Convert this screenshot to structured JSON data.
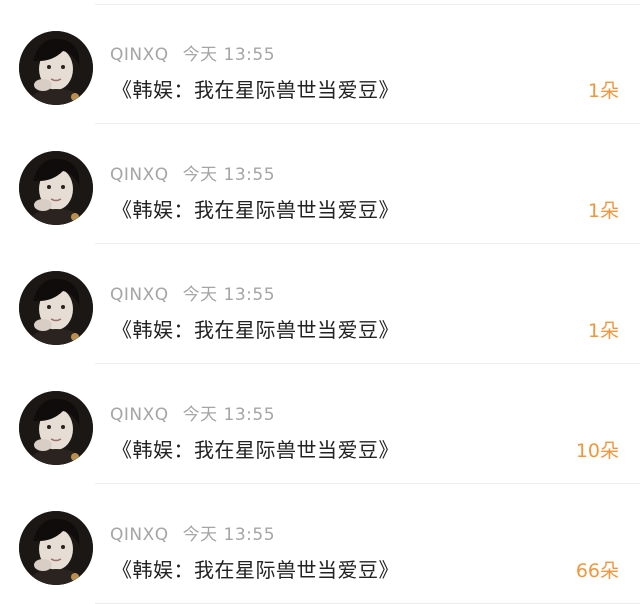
{
  "messages": [
    {
      "username": "QINXQ",
      "time": "今天 13:55",
      "title": "《韩娱：我在星际兽世当爱豆》",
      "amount": "1朵"
    },
    {
      "username": "QINXQ",
      "time": "今天 13:55",
      "title": "《韩娱：我在星际兽世当爱豆》",
      "amount": "1朵"
    },
    {
      "username": "QINXQ",
      "time": "今天 13:55",
      "title": "《韩娱：我在星际兽世当爱豆》",
      "amount": "1朵"
    },
    {
      "username": "QINXQ",
      "time": "今天 13:55",
      "title": "《韩娱：我在星际兽世当爱豆》",
      "amount": "10朵"
    },
    {
      "username": "QINXQ",
      "time": "今天 13:55",
      "title": "《韩娱：我在星际兽世当爱豆》",
      "amount": "66朵"
    }
  ],
  "colors": {
    "amount": "#f0973e",
    "meta": "#a5a5a5",
    "title": "#222222",
    "divider": "#ededed"
  }
}
